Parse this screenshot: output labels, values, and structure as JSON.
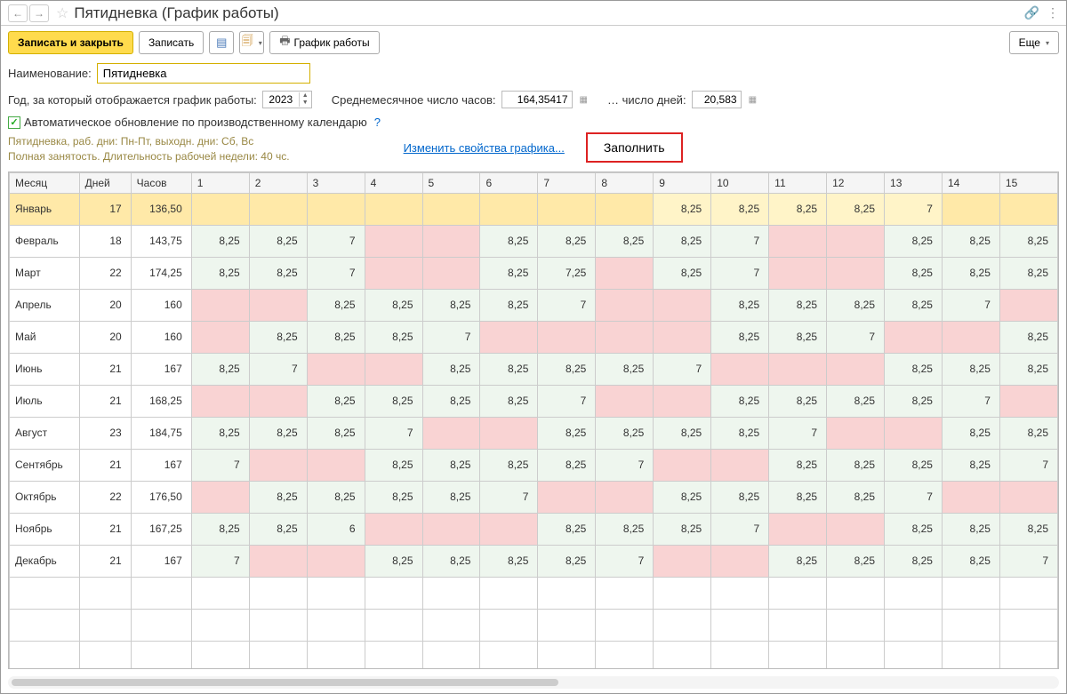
{
  "header": {
    "title": "Пятидневка (График работы)"
  },
  "toolbar": {
    "save_close": "Записать и закрыть",
    "save": "Записать",
    "schedule": "График работы",
    "more": "Еще"
  },
  "form": {
    "name_label": "Наименование:",
    "name_value": "Пятидневка",
    "year_label": "Год, за который отображается график работы:",
    "year_value": "2023",
    "avg_hours_label": "Среднемесячное число часов:",
    "avg_hours_value": "164,35417",
    "avg_days_label": "… число дней:",
    "avg_days_value": "20,583",
    "auto_update_label": "Автоматическое обновление по производственному календарю",
    "info_line1": "Пятидневка, раб. дни: Пн-Пт, выходн. дни: Сб, Вс",
    "info_line2": "Полная занятость. Длительность рабочей недели: 40 чс.",
    "change_props": "Изменить свойства графика...",
    "fill_btn": "Заполнить"
  },
  "table": {
    "headers": {
      "month": "Месяц",
      "days": "Дней",
      "hours": "Часов"
    },
    "day_cols": [
      1,
      2,
      3,
      4,
      5,
      6,
      7,
      8,
      9,
      10,
      11,
      12,
      13,
      14,
      15
    ],
    "rows": [
      {
        "month": "Январь",
        "days": "17",
        "hours": "136,50",
        "selected": true,
        "cells": [
          {
            "v": "",
            "c": "pink"
          },
          {
            "v": "",
            "c": "pink"
          },
          {
            "v": "",
            "c": "pink"
          },
          {
            "v": "",
            "c": "pink"
          },
          {
            "v": "",
            "c": "pink"
          },
          {
            "v": "",
            "c": "pink"
          },
          {
            "v": "",
            "c": "pink"
          },
          {
            "v": "",
            "c": "pink"
          },
          {
            "v": "8,25",
            "c": "work"
          },
          {
            "v": "8,25",
            "c": "work"
          },
          {
            "v": "8,25",
            "c": "work"
          },
          {
            "v": "8,25",
            "c": "work"
          },
          {
            "v": "7",
            "c": "work"
          },
          {
            "v": "",
            "c": "pink"
          },
          {
            "v": "",
            "c": "pink"
          }
        ]
      },
      {
        "month": "Февраль",
        "days": "18",
        "hours": "143,75",
        "cells": [
          {
            "v": "8,25",
            "c": "work"
          },
          {
            "v": "8,25",
            "c": "work"
          },
          {
            "v": "7",
            "c": "work"
          },
          {
            "v": "",
            "c": "pink"
          },
          {
            "v": "",
            "c": "pink"
          },
          {
            "v": "8,25",
            "c": "work"
          },
          {
            "v": "8,25",
            "c": "work"
          },
          {
            "v": "8,25",
            "c": "work"
          },
          {
            "v": "8,25",
            "c": "work"
          },
          {
            "v": "7",
            "c": "work"
          },
          {
            "v": "",
            "c": "pink"
          },
          {
            "v": "",
            "c": "pink"
          },
          {
            "v": "8,25",
            "c": "work"
          },
          {
            "v": "8,25",
            "c": "work"
          },
          {
            "v": "8,25",
            "c": "work"
          }
        ]
      },
      {
        "month": "Март",
        "days": "22",
        "hours": "174,25",
        "cells": [
          {
            "v": "8,25",
            "c": "work"
          },
          {
            "v": "8,25",
            "c": "work"
          },
          {
            "v": "7",
            "c": "work"
          },
          {
            "v": "",
            "c": "pink"
          },
          {
            "v": "",
            "c": "pink"
          },
          {
            "v": "8,25",
            "c": "work"
          },
          {
            "v": "7,25",
            "c": "work"
          },
          {
            "v": "",
            "c": "pink"
          },
          {
            "v": "8,25",
            "c": "work"
          },
          {
            "v": "7",
            "c": "work"
          },
          {
            "v": "",
            "c": "pink"
          },
          {
            "v": "",
            "c": "pink"
          },
          {
            "v": "8,25",
            "c": "work"
          },
          {
            "v": "8,25",
            "c": "work"
          },
          {
            "v": "8,25",
            "c": "work"
          }
        ]
      },
      {
        "month": "Апрель",
        "days": "20",
        "hours": "160",
        "cells": [
          {
            "v": "",
            "c": "pink"
          },
          {
            "v": "",
            "c": "pink"
          },
          {
            "v": "8,25",
            "c": "work"
          },
          {
            "v": "8,25",
            "c": "work"
          },
          {
            "v": "8,25",
            "c": "work"
          },
          {
            "v": "8,25",
            "c": "work"
          },
          {
            "v": "7",
            "c": "work"
          },
          {
            "v": "",
            "c": "pink"
          },
          {
            "v": "",
            "c": "pink"
          },
          {
            "v": "8,25",
            "c": "work"
          },
          {
            "v": "8,25",
            "c": "work"
          },
          {
            "v": "8,25",
            "c": "work"
          },
          {
            "v": "8,25",
            "c": "work"
          },
          {
            "v": "7",
            "c": "work"
          },
          {
            "v": "",
            "c": "pink"
          }
        ]
      },
      {
        "month": "Май",
        "days": "20",
        "hours": "160",
        "cells": [
          {
            "v": "",
            "c": "pink"
          },
          {
            "v": "8,25",
            "c": "work"
          },
          {
            "v": "8,25",
            "c": "work"
          },
          {
            "v": "8,25",
            "c": "work"
          },
          {
            "v": "7",
            "c": "work"
          },
          {
            "v": "",
            "c": "pink"
          },
          {
            "v": "",
            "c": "pink"
          },
          {
            "v": "",
            "c": "pink"
          },
          {
            "v": "",
            "c": "pink"
          },
          {
            "v": "8,25",
            "c": "work"
          },
          {
            "v": "8,25",
            "c": "work"
          },
          {
            "v": "7",
            "c": "work"
          },
          {
            "v": "",
            "c": "pink"
          },
          {
            "v": "",
            "c": "pink"
          },
          {
            "v": "8,25",
            "c": "work"
          }
        ]
      },
      {
        "month": "Июнь",
        "days": "21",
        "hours": "167",
        "cells": [
          {
            "v": "8,25",
            "c": "work"
          },
          {
            "v": "7",
            "c": "work"
          },
          {
            "v": "",
            "c": "pink"
          },
          {
            "v": "",
            "c": "pink"
          },
          {
            "v": "8,25",
            "c": "work"
          },
          {
            "v": "8,25",
            "c": "work"
          },
          {
            "v": "8,25",
            "c": "work"
          },
          {
            "v": "8,25",
            "c": "work"
          },
          {
            "v": "7",
            "c": "work"
          },
          {
            "v": "",
            "c": "pink"
          },
          {
            "v": "",
            "c": "pink"
          },
          {
            "v": "",
            "c": "pink"
          },
          {
            "v": "8,25",
            "c": "work"
          },
          {
            "v": "8,25",
            "c": "work"
          },
          {
            "v": "8,25",
            "c": "work"
          }
        ]
      },
      {
        "month": "Июль",
        "days": "21",
        "hours": "168,25",
        "cells": [
          {
            "v": "",
            "c": "pink"
          },
          {
            "v": "",
            "c": "pink"
          },
          {
            "v": "8,25",
            "c": "work"
          },
          {
            "v": "8,25",
            "c": "work"
          },
          {
            "v": "8,25",
            "c": "work"
          },
          {
            "v": "8,25",
            "c": "work"
          },
          {
            "v": "7",
            "c": "work"
          },
          {
            "v": "",
            "c": "pink"
          },
          {
            "v": "",
            "c": "pink"
          },
          {
            "v": "8,25",
            "c": "work"
          },
          {
            "v": "8,25",
            "c": "work"
          },
          {
            "v": "8,25",
            "c": "work"
          },
          {
            "v": "8,25",
            "c": "work"
          },
          {
            "v": "7",
            "c": "work"
          },
          {
            "v": "",
            "c": "pink"
          }
        ]
      },
      {
        "month": "Август",
        "days": "23",
        "hours": "184,75",
        "cells": [
          {
            "v": "8,25",
            "c": "work"
          },
          {
            "v": "8,25",
            "c": "work"
          },
          {
            "v": "8,25",
            "c": "work"
          },
          {
            "v": "7",
            "c": "work"
          },
          {
            "v": "",
            "c": "pink"
          },
          {
            "v": "",
            "c": "pink"
          },
          {
            "v": "8,25",
            "c": "work"
          },
          {
            "v": "8,25",
            "c": "work"
          },
          {
            "v": "8,25",
            "c": "work"
          },
          {
            "v": "8,25",
            "c": "work"
          },
          {
            "v": "7",
            "c": "work"
          },
          {
            "v": "",
            "c": "pink"
          },
          {
            "v": "",
            "c": "pink"
          },
          {
            "v": "8,25",
            "c": "work"
          },
          {
            "v": "8,25",
            "c": "work"
          }
        ]
      },
      {
        "month": "Сентябрь",
        "days": "21",
        "hours": "167",
        "cells": [
          {
            "v": "7",
            "c": "work"
          },
          {
            "v": "",
            "c": "pink"
          },
          {
            "v": "",
            "c": "pink"
          },
          {
            "v": "8,25",
            "c": "work"
          },
          {
            "v": "8,25",
            "c": "work"
          },
          {
            "v": "8,25",
            "c": "work"
          },
          {
            "v": "8,25",
            "c": "work"
          },
          {
            "v": "7",
            "c": "work"
          },
          {
            "v": "",
            "c": "pink"
          },
          {
            "v": "",
            "c": "pink"
          },
          {
            "v": "8,25",
            "c": "work"
          },
          {
            "v": "8,25",
            "c": "work"
          },
          {
            "v": "8,25",
            "c": "work"
          },
          {
            "v": "8,25",
            "c": "work"
          },
          {
            "v": "7",
            "c": "work"
          }
        ]
      },
      {
        "month": "Октябрь",
        "days": "22",
        "hours": "176,50",
        "cells": [
          {
            "v": "",
            "c": "pink"
          },
          {
            "v": "8,25",
            "c": "work"
          },
          {
            "v": "8,25",
            "c": "work"
          },
          {
            "v": "8,25",
            "c": "work"
          },
          {
            "v": "8,25",
            "c": "work"
          },
          {
            "v": "7",
            "c": "work"
          },
          {
            "v": "",
            "c": "pink"
          },
          {
            "v": "",
            "c": "pink"
          },
          {
            "v": "8,25",
            "c": "work"
          },
          {
            "v": "8,25",
            "c": "work"
          },
          {
            "v": "8,25",
            "c": "work"
          },
          {
            "v": "8,25",
            "c": "work"
          },
          {
            "v": "7",
            "c": "work"
          },
          {
            "v": "",
            "c": "pink"
          },
          {
            "v": "",
            "c": "pink"
          }
        ]
      },
      {
        "month": "Ноябрь",
        "days": "21",
        "hours": "167,25",
        "cells": [
          {
            "v": "8,25",
            "c": "work"
          },
          {
            "v": "8,25",
            "c": "work"
          },
          {
            "v": "6",
            "c": "work"
          },
          {
            "v": "",
            "c": "pink"
          },
          {
            "v": "",
            "c": "pink"
          },
          {
            "v": "",
            "c": "pink"
          },
          {
            "v": "8,25",
            "c": "work"
          },
          {
            "v": "8,25",
            "c": "work"
          },
          {
            "v": "8,25",
            "c": "work"
          },
          {
            "v": "7",
            "c": "work"
          },
          {
            "v": "",
            "c": "pink"
          },
          {
            "v": "",
            "c": "pink"
          },
          {
            "v": "8,25",
            "c": "work"
          },
          {
            "v": "8,25",
            "c": "work"
          },
          {
            "v": "8,25",
            "c": "work"
          }
        ]
      },
      {
        "month": "Декабрь",
        "days": "21",
        "hours": "167",
        "cells": [
          {
            "v": "7",
            "c": "work"
          },
          {
            "v": "",
            "c": "pink"
          },
          {
            "v": "",
            "c": "pink"
          },
          {
            "v": "8,25",
            "c": "work"
          },
          {
            "v": "8,25",
            "c": "work"
          },
          {
            "v": "8,25",
            "c": "work"
          },
          {
            "v": "8,25",
            "c": "work"
          },
          {
            "v": "7",
            "c": "work"
          },
          {
            "v": "",
            "c": "pink"
          },
          {
            "v": "",
            "c": "pink"
          },
          {
            "v": "8,25",
            "c": "work"
          },
          {
            "v": "8,25",
            "c": "work"
          },
          {
            "v": "8,25",
            "c": "work"
          },
          {
            "v": "8,25",
            "c": "work"
          },
          {
            "v": "7",
            "c": "work"
          }
        ]
      }
    ]
  }
}
